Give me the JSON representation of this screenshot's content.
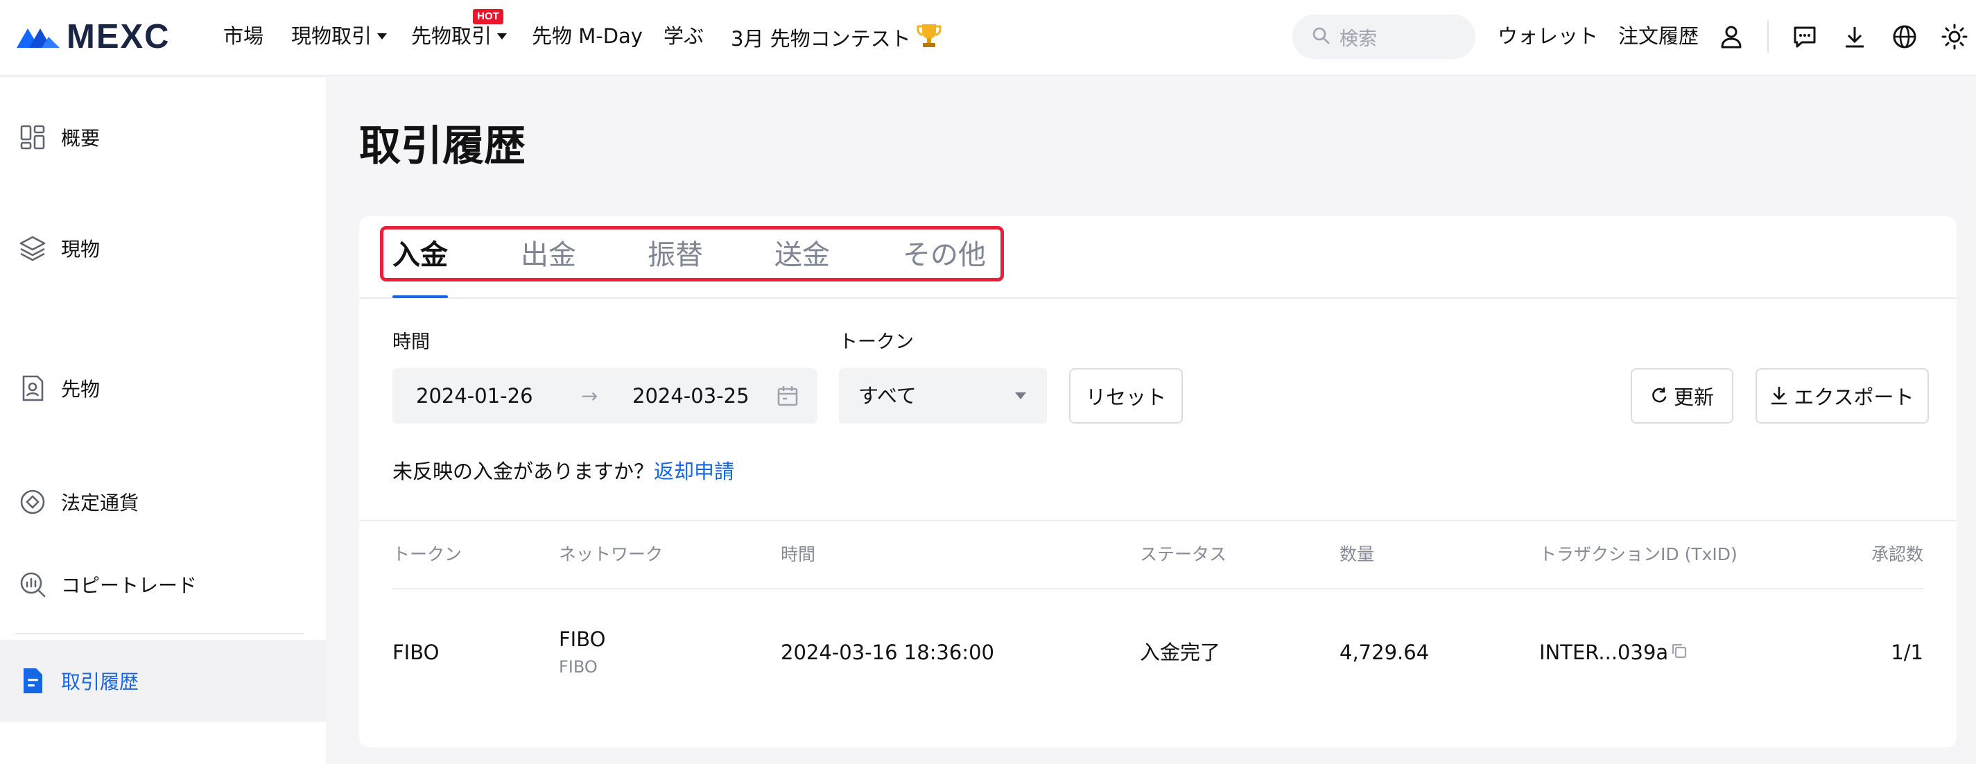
{
  "brand": {
    "name": "MEXC",
    "logo_color": "#1667ff",
    "text_color": "#1a2544"
  },
  "topnav": {
    "items": [
      {
        "label": "市場"
      },
      {
        "label": "現物取引"
      },
      {
        "label": "先物取引",
        "badge": "HOT"
      },
      {
        "label": "先物 M-Day"
      },
      {
        "label": "学ぶ"
      },
      {
        "label": "3月 先物コンテスト"
      }
    ],
    "search": {
      "placeholder": "検索"
    },
    "links": {
      "wallet": "ウォレット",
      "order_history": "注文履歴"
    },
    "icons": [
      "user-icon",
      "chat-icon",
      "download-icon",
      "globe-icon",
      "theme-icon"
    ]
  },
  "sidebar": {
    "items": [
      {
        "label": "概要",
        "icon": "overview-icon"
      },
      {
        "label": "現物",
        "icon": "spot-icon"
      },
      {
        "label": "先物",
        "icon": "futures-icon"
      },
      {
        "label": "法定通貨",
        "icon": "fiat-icon"
      },
      {
        "label": "コピートレード",
        "icon": "copy-trade-icon"
      },
      {
        "label": "取引履歴",
        "icon": "history-icon",
        "active": true
      }
    ],
    "active_color": "#1567e6"
  },
  "main": {
    "title": "取引履歴",
    "tabs": [
      {
        "label": "入金",
        "active": true
      },
      {
        "label": "出金"
      },
      {
        "label": "振替"
      },
      {
        "label": "送金"
      },
      {
        "label": "その他"
      }
    ],
    "highlight_color": "#e8213a",
    "filters": {
      "time_label": "時間",
      "date_start": "2024-01-26",
      "date_arrow": "→",
      "date_end": "2024-03-25",
      "token_label": "トークン",
      "token_value": "すべて",
      "reset_label": "リセット",
      "refresh_label": "更新",
      "export_label": "エクスポート"
    },
    "notice": {
      "text": "未反映の入金がありますか？",
      "link": "返却申請"
    },
    "table": {
      "headers": [
        "トークン",
        "ネットワーク",
        "時間",
        "ステータス",
        "数量",
        "トラザクションID (TxID)",
        "承認数"
      ],
      "rows": [
        {
          "token": "FIBO",
          "network": "FIBO",
          "network_sub": "FIBO",
          "time": "2024-03-16 18:36:00",
          "status": "入金完了",
          "amount": "4,729.64",
          "txid": "INTER...039a",
          "confirmations": "1/1"
        }
      ]
    }
  }
}
